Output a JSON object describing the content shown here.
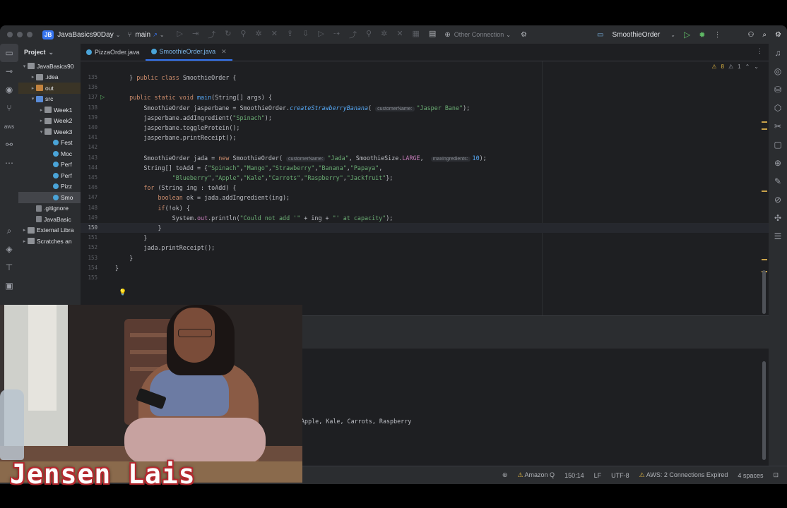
{
  "title_bar": {
    "project_badge": "JB",
    "project_name": "JavaBasics90Day",
    "branch": "main",
    "connection": "Other Connection",
    "run_config": "SmoothieOrder"
  },
  "project_panel": {
    "title": "Project",
    "tree": [
      {
        "label": "JavaBasics90",
        "depth": 0,
        "icon": "folder-icon",
        "arrow": "▾"
      },
      {
        "label": ".idea",
        "depth": 1,
        "icon": "folder-icon",
        "arrow": "▸"
      },
      {
        "label": "out",
        "depth": 1,
        "icon": "folder-orange-icon",
        "arrow": "▸"
      },
      {
        "label": "src",
        "depth": 1,
        "icon": "folder-blue-icon",
        "arrow": "▾"
      },
      {
        "label": "Week1",
        "depth": 2,
        "icon": "folder-icon",
        "arrow": "▸"
      },
      {
        "label": "Week2",
        "depth": 2,
        "icon": "folder-icon",
        "arrow": "▸"
      },
      {
        "label": "Week3",
        "depth": 2,
        "icon": "folder-icon",
        "arrow": "▾"
      },
      {
        "label": "Fest",
        "depth": 3,
        "icon": "java-class-icon",
        "arrow": ""
      },
      {
        "label": "Moc",
        "depth": 3,
        "icon": "java-class-icon",
        "arrow": ""
      },
      {
        "label": "Perf",
        "depth": 3,
        "icon": "java-class-icon",
        "arrow": ""
      },
      {
        "label": "Perf",
        "depth": 3,
        "icon": "java-class-icon",
        "arrow": ""
      },
      {
        "label": "Pizz",
        "depth": 3,
        "icon": "java-class-icon",
        "arrow": ""
      },
      {
        "label": "Smo",
        "depth": 3,
        "icon": "java-class-icon",
        "arrow": "",
        "selected": true
      },
      {
        "label": ".gitignore",
        "depth": 1,
        "icon": "file-icon",
        "arrow": ""
      },
      {
        "label": "JavaBasic",
        "depth": 1,
        "icon": "file-icon",
        "arrow": ""
      },
      {
        "label": "External Libra",
        "depth": 0,
        "icon": "library-icon",
        "arrow": "▸"
      },
      {
        "label": "Scratches an",
        "depth": 0,
        "icon": "scratches-icon",
        "arrow": "▸"
      }
    ]
  },
  "tabs": [
    {
      "label": "PizzaOrder.java",
      "active": false
    },
    {
      "label": "SmoothieOrder.java",
      "active": true
    }
  ],
  "problems": {
    "warnings": "8",
    "weak_warnings": "1"
  },
  "editor": {
    "sticky": "public class SmoothieOrder {",
    "lines": [
      {
        "n": "135",
        "segs": [
          {
            "t": "    }",
            "c": ""
          }
        ]
      },
      {
        "n": "136",
        "segs": [
          {
            "t": "",
            "c": ""
          }
        ]
      },
      {
        "n": "137",
        "segs": [
          {
            "t": "    ",
            "c": ""
          },
          {
            "t": "public static void ",
            "c": "kw"
          },
          {
            "t": "main",
            "c": "fn"
          },
          {
            "t": "(String[] args) {",
            "c": ""
          }
        ],
        "run": true
      },
      {
        "n": "138",
        "segs": [
          {
            "t": "        SmoothieOrder jasperbane = SmoothieOrder.",
            "c": ""
          },
          {
            "t": "createStrawberryBanana",
            "c": "it"
          },
          {
            "t": "( ",
            "c": ""
          },
          {
            "t": "customerName:",
            "c": "hint"
          },
          {
            "t": "\"Jasper Bane\"",
            "c": "str"
          },
          {
            "t": ");",
            "c": ""
          }
        ]
      },
      {
        "n": "139",
        "segs": [
          {
            "t": "        jasperbane.addIngredient(",
            "c": ""
          },
          {
            "t": "\"Spinach\"",
            "c": "str"
          },
          {
            "t": ");",
            "c": ""
          }
        ]
      },
      {
        "n": "140",
        "segs": [
          {
            "t": "        jasperbane.toggleProtein();",
            "c": ""
          }
        ]
      },
      {
        "n": "141",
        "segs": [
          {
            "t": "        jasperbane.printReceipt();",
            "c": ""
          }
        ]
      },
      {
        "n": "142",
        "segs": [
          {
            "t": "",
            "c": ""
          }
        ]
      },
      {
        "n": "143",
        "segs": [
          {
            "t": "        SmoothieOrder jada = ",
            "c": ""
          },
          {
            "t": "new ",
            "c": "kw"
          },
          {
            "t": "SmoothieOrder( ",
            "c": ""
          },
          {
            "t": "customerName:",
            "c": "hint"
          },
          {
            "t": "\"Jada\"",
            "c": "str"
          },
          {
            "t": ", SmoothieSize.",
            "c": ""
          },
          {
            "t": "LARGE",
            "c": "fld"
          },
          {
            "t": ",  ",
            "c": ""
          },
          {
            "t": "maxIngredients:",
            "c": "hint"
          },
          {
            "t": "10",
            "c": "fn"
          },
          {
            "t": ");",
            "c": ""
          }
        ]
      },
      {
        "n": "144",
        "segs": [
          {
            "t": "        String[] toAdd = {",
            "c": ""
          },
          {
            "t": "\"Spinach\"",
            "c": "str"
          },
          {
            "t": ",",
            "c": ""
          },
          {
            "t": "\"Mango\"",
            "c": "str"
          },
          {
            "t": ",",
            "c": ""
          },
          {
            "t": "\"Strawberry\"",
            "c": "str"
          },
          {
            "t": ",",
            "c": ""
          },
          {
            "t": "\"Banana\"",
            "c": "str"
          },
          {
            "t": ",",
            "c": ""
          },
          {
            "t": "\"Papaya\"",
            "c": "str"
          },
          {
            "t": ",",
            "c": ""
          }
        ]
      },
      {
        "n": "145",
        "segs": [
          {
            "t": "                \"Blueberry\"",
            "c": "str"
          },
          {
            "t": ",",
            "c": ""
          },
          {
            "t": "\"Apple\"",
            "c": "str"
          },
          {
            "t": ",",
            "c": ""
          },
          {
            "t": "\"Kale\"",
            "c": "str"
          },
          {
            "t": ",",
            "c": ""
          },
          {
            "t": "\"Carrots\"",
            "c": "str"
          },
          {
            "t": ",",
            "c": ""
          },
          {
            "t": "\"Raspberry\"",
            "c": "str"
          },
          {
            "t": ",",
            "c": ""
          },
          {
            "t": "\"Jackfruit\"",
            "c": "str"
          },
          {
            "t": "};",
            "c": ""
          }
        ]
      },
      {
        "n": "146",
        "segs": [
          {
            "t": "        ",
            "c": ""
          },
          {
            "t": "for ",
            "c": "kw"
          },
          {
            "t": "(String ing : toAdd) {",
            "c": ""
          }
        ]
      },
      {
        "n": "147",
        "segs": [
          {
            "t": "            ",
            "c": ""
          },
          {
            "t": "boolean ",
            "c": "kw"
          },
          {
            "t": "ok = jada.addIngredient(ing);",
            "c": ""
          }
        ]
      },
      {
        "n": "148",
        "segs": [
          {
            "t": "            ",
            "c": ""
          },
          {
            "t": "if",
            "c": "kw"
          },
          {
            "t": "(!ok) {",
            "c": ""
          }
        ]
      },
      {
        "n": "149",
        "segs": [
          {
            "t": "                System.",
            "c": ""
          },
          {
            "t": "out",
            "c": "fld"
          },
          {
            "t": ".println(",
            "c": ""
          },
          {
            "t": "\"Could not add '\"",
            "c": "str"
          },
          {
            "t": " + ing + ",
            "c": ""
          },
          {
            "t": "\"' at capacity\"",
            "c": "str"
          },
          {
            "t": ");",
            "c": ""
          }
        ]
      },
      {
        "n": "150",
        "segs": [
          {
            "t": "            }",
            "c": ""
          }
        ],
        "current": true
      },
      {
        "n": "151",
        "segs": [
          {
            "t": "        }",
            "c": ""
          }
        ]
      },
      {
        "n": "152",
        "segs": [
          {
            "t": "        jada.printReceipt();",
            "c": ""
          }
        ]
      },
      {
        "n": "153",
        "segs": [
          {
            "t": "    }",
            "c": ""
          }
        ]
      },
      {
        "n": "154",
        "segs": [
          {
            "t": "}",
            "c": ""
          }
        ]
      },
      {
        "n": "155",
        "segs": [
          {
            "t": "",
            "c": ""
          }
        ]
      }
    ]
  },
  "console": {
    "visible_text": "Apple, Kale, Carrots, Raspberry"
  },
  "status_bar": {
    "branch_fragment": "main",
    "amazon_q": "Amazon Q",
    "position": "150:14",
    "line_sep": "LF",
    "encoding": "UTF-8",
    "aws": "AWS: 2 Connections Expired",
    "indent": "4 spaces"
  },
  "overlay": {
    "streamer_name": "Jensen Lais"
  },
  "colors": {
    "accent": "#3574f0",
    "keyword": "#cf8e6d",
    "string": "#6aab73",
    "function": "#56a8f5",
    "field": "#c77dbb",
    "warning": "#e0b643",
    "run": "#5fb865"
  }
}
